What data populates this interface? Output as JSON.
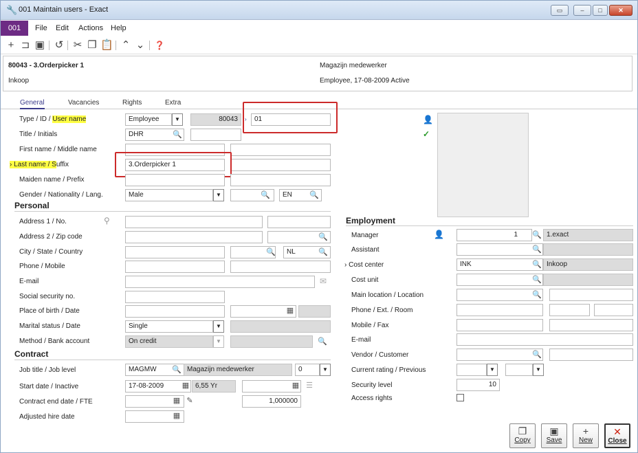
{
  "window": {
    "title": "001 Maintain users - Exact",
    "controls": [
      "restore-icon",
      "minimize-icon",
      "maximize-icon",
      "close-icon"
    ]
  },
  "menubar": {
    "badge": "001",
    "items": [
      "File",
      "Edit",
      "Actions",
      "Help"
    ]
  },
  "toolbar": {
    "icons": [
      "new-icon",
      "open-icon",
      "save-icon",
      "undo-icon",
      "cut-icon",
      "copy-icon",
      "paste-icon",
      "up-icon",
      "down-icon",
      "help-icon"
    ]
  },
  "header": {
    "id_name": "80043 -  3.Orderpicker 1",
    "department": "Inkoop",
    "function": "Magazijn medewerker",
    "status": "Employee, 17-08-2009  Active"
  },
  "tabs": [
    "General",
    "Vacancies",
    "Rights",
    "Extra"
  ],
  "general": {
    "type_label_prefix": "Type / ID / ",
    "type_label_hl": "User name",
    "type_value": "Employee",
    "id_value": "80043",
    "username_value": "01",
    "title_label": "Title / Initials",
    "title_value": "DHR",
    "firstname_label": "First name / Middle name",
    "lastname_label_hl": "Last name / S",
    "lastname_label_rest": "uffix",
    "lastname_value": "3.Orderpicker 1",
    "maiden_label": "Maiden name / Prefix",
    "gender_label": "Gender / Nationality / Lang.",
    "gender_value": "Male",
    "language_value": "EN"
  },
  "personal": {
    "title": "Personal",
    "address1_label": "Address 1 / No.",
    "address2_label": "Address 2 / Zip code",
    "city_label": "City / State / Country",
    "country_value": "NL",
    "phone_label": "Phone / Mobile",
    "email_label": "E-mail",
    "ssn_label": "Social security no.",
    "birth_label": "Place of birth / Date",
    "marital_label": "Marital status / Date",
    "marital_value": "Single",
    "method_label": "Method / Bank account",
    "method_value": "On credit"
  },
  "contract": {
    "title": "Contract",
    "job_label": "Job title / Job level",
    "job_code": "MAGMW",
    "job_desc": "Magazijn medewerker",
    "job_level": "0",
    "start_label": "Start date / Inactive",
    "start_value": "17-08-2009",
    "years_value": "6,55 Yr",
    "end_label": "Contract end date / FTE",
    "fte_value": "1,000000",
    "hire_label": "Adjusted hire date"
  },
  "employment": {
    "title": "Employment",
    "manager_label": "Manager",
    "manager_value": "1",
    "manager_desc": "1.exact",
    "assistant_label": "Assistant",
    "cost_center_label": "Cost center",
    "cost_center_value": "INK",
    "cost_center_desc": "Inkoop",
    "cost_unit_label": "Cost unit",
    "location_label": "Main location / Location",
    "phone_label": "Phone / Ext. / Room",
    "mobile_label": "Mobile / Fax",
    "email_label": "E-mail",
    "vendor_label": "Vendor / Customer",
    "rating_label": "Current rating / Previous",
    "security_label": "Security level",
    "security_value": "10",
    "access_label": "Access rights"
  },
  "buttons": {
    "copy": "Copy",
    "save": "Save",
    "new": "New",
    "close": "Close"
  }
}
